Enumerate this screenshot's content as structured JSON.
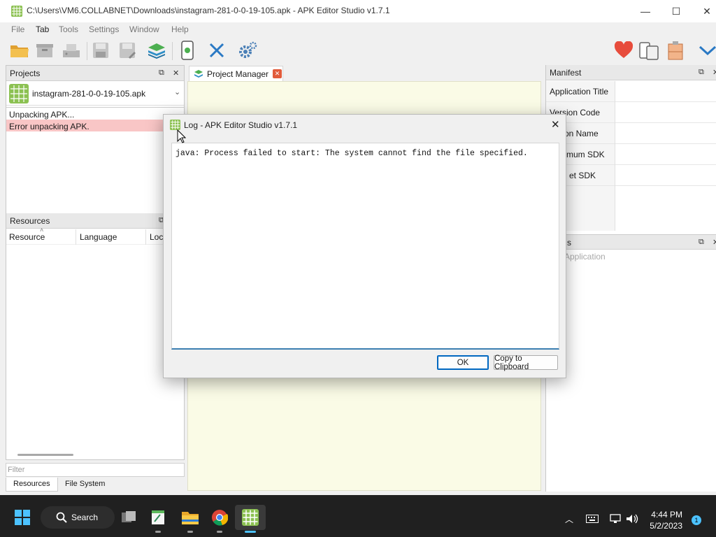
{
  "window": {
    "title": "C:\\Users\\VM6.COLLABNET\\Downloads\\instagram-281-0-0-19-105.apk - APK Editor Studio v1.7.1",
    "minimize": "—",
    "maximize": "☐",
    "close": "✕"
  },
  "menu": [
    "File",
    "Tab",
    "Tools",
    "Settings",
    "Window",
    "Help"
  ],
  "toolbar_icons": [
    "open-folder",
    "save-archive",
    "install",
    "save",
    "save-as",
    "layers",
    "device-apk",
    "close-x",
    "settings-gear",
    "donate-heart",
    "devices",
    "keystore",
    "more-chevron"
  ],
  "projects": {
    "header": "Projects",
    "selected": "instagram-281-0-0-19-105.apk",
    "log": [
      {
        "text": "Unpacking APK...",
        "status": "normal"
      },
      {
        "text": "Error unpacking APK.",
        "status": "error"
      }
    ]
  },
  "resources": {
    "header": "Resources",
    "columns": [
      "Resource",
      "Language",
      "Loca"
    ]
  },
  "filter_placeholder": "Filter",
  "bottom_tabs": [
    "Resources",
    "File System"
  ],
  "center": {
    "tab": "Project Manager"
  },
  "manifest": {
    "header": "Manifest",
    "rows": [
      "Application Title",
      "Version Code",
      "on Name",
      "mum SDK",
      "et SDK"
    ]
  },
  "permissions": {
    "header_partial": "s",
    "item": "Application"
  },
  "dialog": {
    "title": "Log - APK Editor Studio v1.7.1",
    "close": "✕",
    "message": "java: Process failed to start: The system cannot find the file specified.",
    "ok": "OK",
    "copy": "Copy to Clipboard"
  },
  "taskbar": {
    "search": "Search",
    "time": "4:44 PM",
    "date": "5/2/2023",
    "notification_count": "1"
  },
  "colors": {
    "error_bg": "#f9c6c6",
    "pm_bg": "#fafbe6",
    "accent": "#0067c0",
    "taskbar": "#202020"
  }
}
